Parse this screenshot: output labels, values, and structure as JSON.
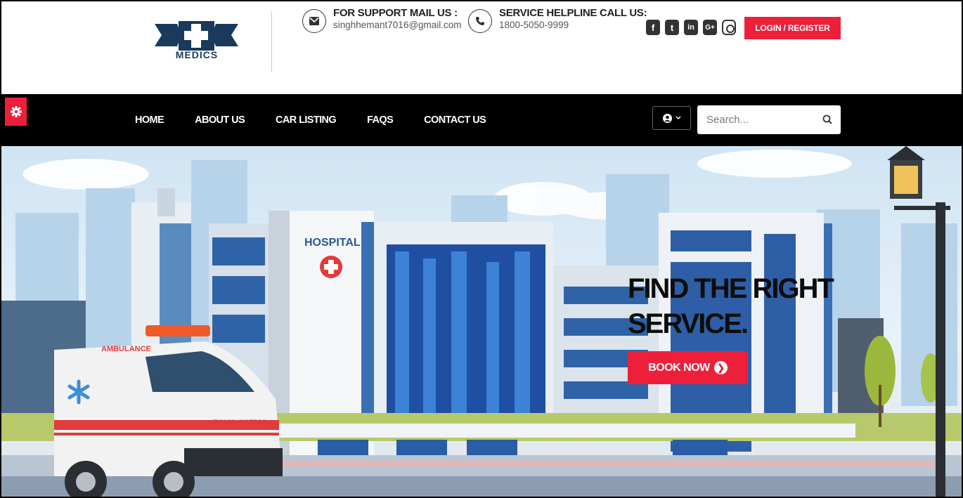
{
  "brand": {
    "logo_text": "MEDICS"
  },
  "contacts": {
    "mail": {
      "label": "FOR SUPPORT MAIL US :",
      "value": "singhhemant7016@gmail.com"
    },
    "phone": {
      "label": "SERVICE HELPLINE CALL US:",
      "value": "1800-5050-9999"
    }
  },
  "socials": [
    {
      "name": "facebook-icon",
      "glyph": "f"
    },
    {
      "name": "twitter-icon",
      "glyph": "t"
    },
    {
      "name": "linkedin-icon",
      "glyph": "in"
    },
    {
      "name": "google-plus-icon",
      "glyph": "G+"
    },
    {
      "name": "instagram-icon",
      "glyph": ""
    }
  ],
  "header": {
    "login_label": "LOGIN / REGISTER"
  },
  "nav": {
    "items": [
      {
        "label": "HOME"
      },
      {
        "label": "ABOUT US"
      },
      {
        "label": "CAR LISTING"
      },
      {
        "label": "FAQS"
      },
      {
        "label": "CONTACT US"
      }
    ],
    "search_placeholder": "Search..."
  },
  "hero": {
    "title": "FIND THE RIGHT SERVICE.",
    "button_label": "BOOK NOW",
    "hospital_sign": "HOSPITAL",
    "ambulance_text": "AMBULANCE",
    "ambulance_mirror_text": "AMBULANCE"
  },
  "colors": {
    "accent": "#ee1f3b",
    "nav_bg": "#000000",
    "logo_blue": "#1a3a5c"
  }
}
